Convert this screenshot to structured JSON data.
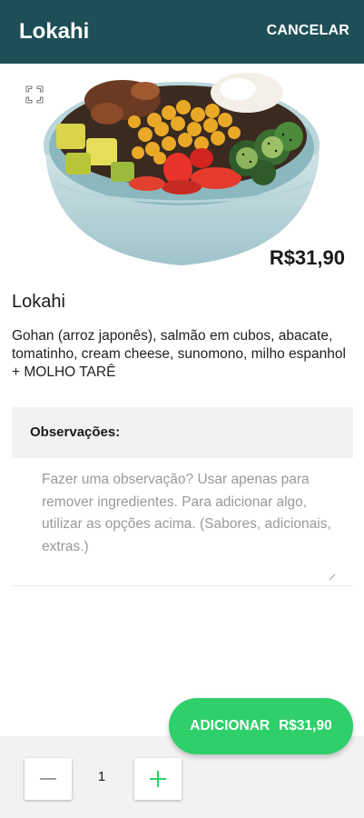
{
  "app_bar": {
    "title": "Lokahi",
    "cancel_label": "CANCELAR"
  },
  "product": {
    "image_icon": "expand-icon",
    "price": "R$31,90",
    "name": "Lokahi",
    "description": "Gohan (arroz japonês), salmão em cubos, abacate, tomatinho, cream cheese, sunomono, milho espanhol + MOLHO TARÊ"
  },
  "observations": {
    "label": "Observações:",
    "placeholder": "Fazer uma observação? Usar apenas para remover ingredientes. Para adicionar algo, utilizar as opções acima. (Sabores, adicionais, extras.)"
  },
  "add_button": {
    "label": "ADICIONAR",
    "price": "R$31,90"
  },
  "quantity": {
    "value": "1",
    "minus_icon": "minus-icon",
    "plus_icon": "plus-icon"
  },
  "colors": {
    "app_bar": "#1f4f56",
    "accent_green": "#2fcf6a"
  }
}
